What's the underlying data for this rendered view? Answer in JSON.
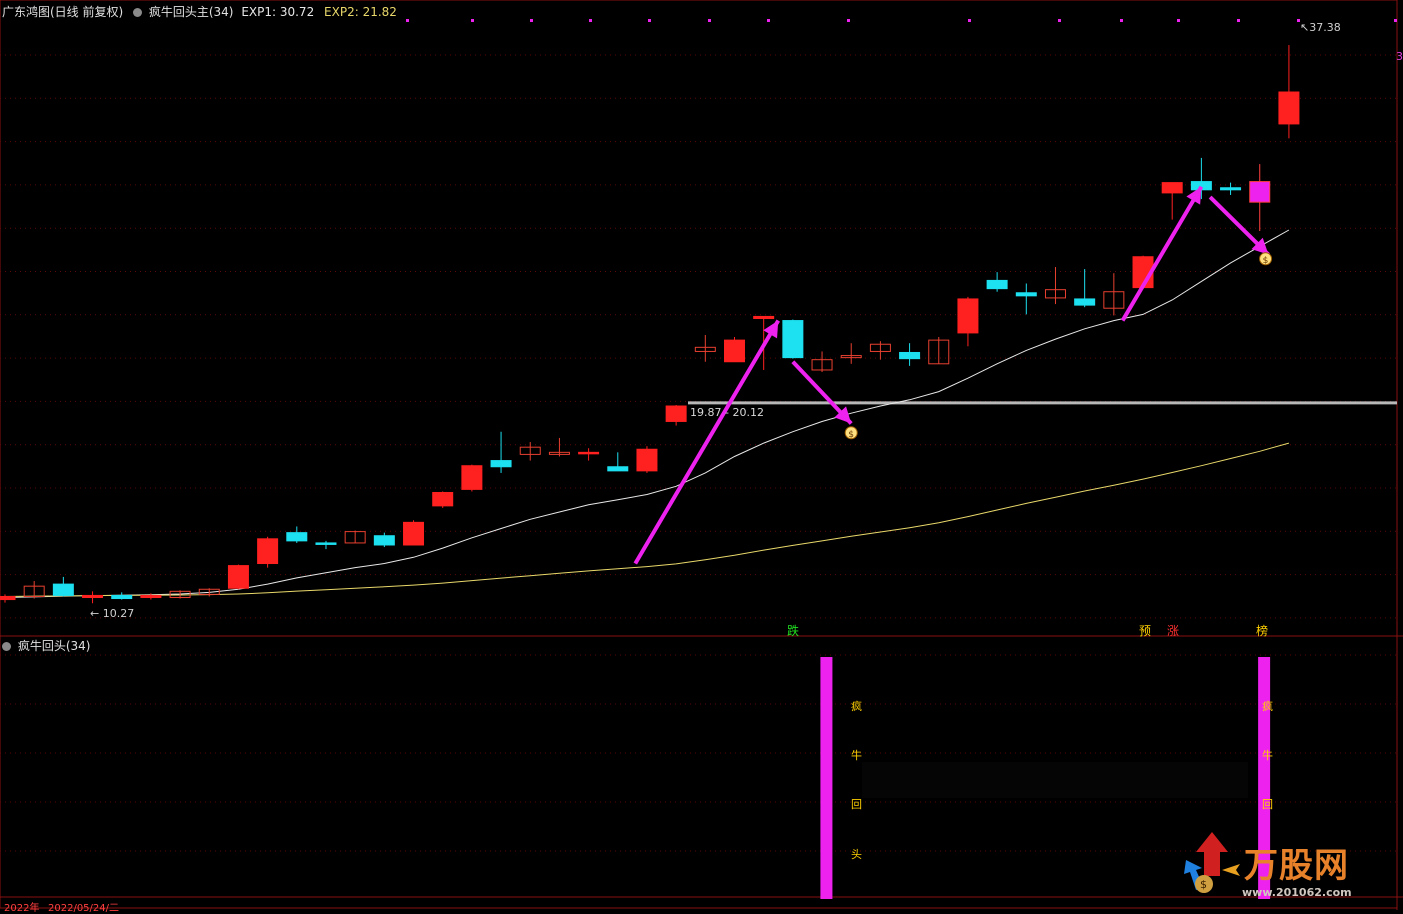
{
  "header": {
    "title": "广东鸿图(日线 前复权)",
    "indicator": "疯牛回头主(34)",
    "exp1": "EXP1: 30.72",
    "exp2": "EXP2: 21.82"
  },
  "sub_header": {
    "indicator": "疯牛回头(34)"
  },
  "price_labels": {
    "high": "37.38",
    "low": "10.27",
    "range": "19.87 - 20.12",
    "right_edge": "3"
  },
  "markers": {
    "die": "跌",
    "yu": "预",
    "zhang": "涨",
    "bang": "榜"
  },
  "signal_text": [
    "疯",
    "牛",
    "回",
    "头"
  ],
  "bottom_dates": {
    "left": "2022年",
    "mid": "2022/05/24/二"
  },
  "watermark": {
    "title": "万股网",
    "url": "www.201062.com"
  },
  "colors": {
    "up": "#ff2020",
    "down": "#1de0f0",
    "signal": "#ee22ee",
    "ma_fast": "#e8e8e8",
    "ma_slow": "#e8d86a",
    "exp1": "#e8e8e8",
    "exp2": "#e8d86a"
  },
  "chart_data": {
    "type": "candlestick",
    "candles": [
      {
        "o": 10.45,
        "h": 10.7,
        "l": 10.3,
        "c": 10.6,
        "color": "up"
      },
      {
        "o": 10.6,
        "h": 11.35,
        "l": 10.5,
        "c": 11.1,
        "color": "up_hollow"
      },
      {
        "o": 11.2,
        "h": 11.55,
        "l": 10.6,
        "c": 10.65,
        "color": "down"
      },
      {
        "o": 10.65,
        "h": 10.85,
        "l": 10.27,
        "c": 10.55,
        "color": "up"
      },
      {
        "o": 10.65,
        "h": 10.8,
        "l": 10.45,
        "c": 10.5,
        "color": "down"
      },
      {
        "o": 10.55,
        "h": 10.75,
        "l": 10.45,
        "c": 10.65,
        "color": "up"
      },
      {
        "o": 10.55,
        "h": 10.9,
        "l": 10.5,
        "c": 10.85,
        "color": "up_hollow"
      },
      {
        "o": 10.7,
        "h": 11.0,
        "l": 10.6,
        "c": 10.95,
        "color": "up_hollow"
      },
      {
        "o": 11.0,
        "h": 12.15,
        "l": 10.95,
        "c": 12.1,
        "color": "up"
      },
      {
        "o": 12.2,
        "h": 13.5,
        "l": 12.0,
        "c": 13.4,
        "color": "up"
      },
      {
        "o": 13.7,
        "h": 14.0,
        "l": 13.2,
        "c": 13.3,
        "color": "down"
      },
      {
        "o": 13.2,
        "h": 13.3,
        "l": 12.9,
        "c": 13.15,
        "color": "down"
      },
      {
        "o": 13.2,
        "h": 13.8,
        "l": 13.2,
        "c": 13.75,
        "color": "up_hollow"
      },
      {
        "o": 13.55,
        "h": 13.7,
        "l": 13.0,
        "c": 13.1,
        "color": "down"
      },
      {
        "o": 13.1,
        "h": 14.3,
        "l": 13.1,
        "c": 14.2,
        "color": "up"
      },
      {
        "o": 15.0,
        "h": 15.7,
        "l": 14.9,
        "c": 15.65,
        "color": "up"
      },
      {
        "o": 15.8,
        "h": 17.0,
        "l": 15.7,
        "c": 16.95,
        "color": "up"
      },
      {
        "o": 17.2,
        "h": 18.6,
        "l": 16.6,
        "c": 16.9,
        "color": "down"
      },
      {
        "o": 17.5,
        "h": 18.1,
        "l": 17.2,
        "c": 17.85,
        "color": "up_hollow"
      },
      {
        "o": 17.6,
        "h": 18.3,
        "l": 17.4,
        "c": 17.5,
        "color": "up_hollow"
      },
      {
        "o": 17.55,
        "h": 17.8,
        "l": 17.2,
        "c": 17.6,
        "color": "up"
      },
      {
        "o": 16.9,
        "h": 17.6,
        "l": 16.7,
        "c": 16.7,
        "color": "down"
      },
      {
        "o": 16.7,
        "h": 17.9,
        "l": 16.6,
        "c": 17.75,
        "color": "up"
      },
      {
        "o": 19.1,
        "h": 19.9,
        "l": 18.9,
        "c": 19.85,
        "color": "up"
      },
      {
        "o": 22.5,
        "h": 23.3,
        "l": 22.0,
        "c": 22.7,
        "color": "up_hollow"
      },
      {
        "o": 22.0,
        "h": 23.2,
        "l": 22.0,
        "c": 23.05,
        "color": "up"
      },
      {
        "o": 24.2,
        "h": 24.2,
        "l": 21.6,
        "c": 24.1,
        "color": "up"
      },
      {
        "o": 24.0,
        "h": 24.05,
        "l": 22.15,
        "c": 22.2,
        "color": "down"
      },
      {
        "o": 21.6,
        "h": 22.5,
        "l": 21.5,
        "c": 22.1,
        "color": "up_hollow"
      },
      {
        "o": 22.3,
        "h": 22.9,
        "l": 21.9,
        "c": 22.2,
        "color": "up_hollow"
      },
      {
        "o": 22.5,
        "h": 23.0,
        "l": 22.1,
        "c": 22.85,
        "color": "up_hollow"
      },
      {
        "o": 22.45,
        "h": 22.9,
        "l": 21.8,
        "c": 22.15,
        "color": "down"
      },
      {
        "o": 21.9,
        "h": 23.2,
        "l": 21.9,
        "c": 23.05,
        "color": "up_hollow"
      },
      {
        "o": 23.4,
        "h": 25.15,
        "l": 22.75,
        "c": 25.05,
        "color": "up"
      },
      {
        "o": 25.95,
        "h": 26.35,
        "l": 25.4,
        "c": 25.55,
        "color": "down"
      },
      {
        "o": 25.35,
        "h": 25.8,
        "l": 24.3,
        "c": 25.2,
        "color": "down"
      },
      {
        "o": 25.1,
        "h": 26.6,
        "l": 24.8,
        "c": 25.5,
        "color": "up_hollow"
      },
      {
        "o": 25.05,
        "h": 26.5,
        "l": 24.65,
        "c": 24.75,
        "color": "down"
      },
      {
        "o": 24.6,
        "h": 26.3,
        "l": 24.25,
        "c": 25.4,
        "color": "up_hollow"
      },
      {
        "o": 25.6,
        "h": 27.15,
        "l": 25.6,
        "c": 27.1,
        "color": "up"
      },
      {
        "o": 30.2,
        "h": 30.65,
        "l": 28.9,
        "c": 30.7,
        "color": "up"
      },
      {
        "o": 30.75,
        "h": 31.9,
        "l": 29.9,
        "c": 30.35,
        "color": "down"
      },
      {
        "o": 30.45,
        "h": 30.7,
        "l": 30.1,
        "c": 30.35,
        "color": "down"
      },
      {
        "o": 29.75,
        "h": 31.6,
        "l": 28.35,
        "c": 30.75,
        "color": "signal"
      },
      {
        "o": 33.55,
        "h": 37.38,
        "l": 32.85,
        "c": 35.1,
        "color": "up"
      }
    ],
    "ma_fast": [
      10.55,
      10.58,
      10.62,
      10.64,
      10.66,
      10.68,
      10.72,
      10.8,
      10.95,
      11.2,
      11.5,
      11.75,
      12.0,
      12.2,
      12.5,
      12.95,
      13.45,
      13.9,
      14.35,
      14.7,
      15.05,
      15.3,
      15.55,
      15.95,
      16.6,
      17.4,
      18.05,
      18.6,
      19.1,
      19.5,
      19.85,
      20.15,
      20.55,
      21.2,
      21.9,
      22.55,
      23.1,
      23.6,
      24.0,
      24.3,
      25.0,
      25.9,
      26.8,
      27.6,
      28.4
    ],
    "ma_slow": [
      10.6,
      10.62,
      10.63,
      10.64,
      10.65,
      10.66,
      10.67,
      10.69,
      10.72,
      10.78,
      10.86,
      10.93,
      11.0,
      11.07,
      11.15,
      11.25,
      11.37,
      11.49,
      11.61,
      11.73,
      11.84,
      11.95,
      12.05,
      12.18,
      12.38,
      12.6,
      12.85,
      13.08,
      13.3,
      13.52,
      13.73,
      13.94,
      14.18,
      14.48,
      14.8,
      15.12,
      15.42,
      15.72,
      16.0,
      16.3,
      16.62,
      16.95,
      17.3,
      17.65,
      18.05
    ],
    "signal_bars": [
      28,
      43
    ],
    "ylim": [
      9.7,
      38.5
    ]
  }
}
